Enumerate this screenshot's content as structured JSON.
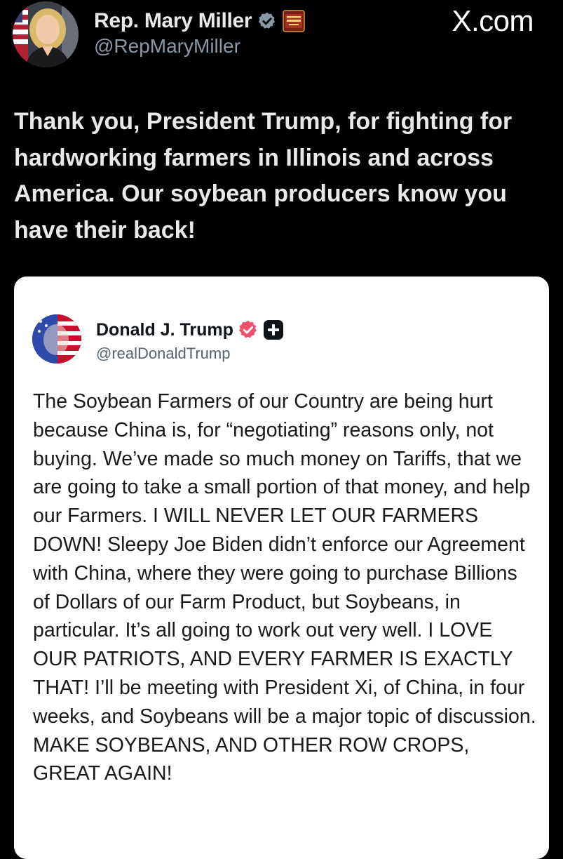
{
  "post": {
    "author": {
      "name": "Rep. Mary Miller",
      "handle": "@RepMaryMiller",
      "avatar_icon": "profile-photo",
      "verified_color": "#8b98a5"
    },
    "site_label": "X.com",
    "text": "Thank you, President Trump, for fighting for hardworking farmers in Illinois and across America. Our soybean producers know you have their back!"
  },
  "quoted_post": {
    "author": {
      "name": "Donald J. Trump",
      "handle": "@realDonaldTrump",
      "avatar_icon": "flag-portrait",
      "verified_color": "#f0506e"
    },
    "text": "The Soybean Farmers of our Country are being hurt because China is, for “negotiating” reasons only, not buying. We’ve made so much money on Tariffs, that we are going to take a small portion of that money, and help our Farmers. I WILL NEVER LET OUR FARMERS DOWN! Sleepy Joe Biden didn’t enforce our Agreement with China, where they were going to purchase Billions of Dollars of our Farm Product, but Soybeans, in particular. It’s all going to work out very well. I LOVE OUR PATRIOTS, AND EVERY FARMER IS EXACTLY THAT! I’ll be meeting with President Xi, of China, in four weeks, and Soybeans will be a major topic of discussion. MAKE SOYBEANS, AND OTHER ROW CROPS, GREAT AGAIN!"
  },
  "colors": {
    "background": "#000000",
    "card": "#ffffff",
    "primary_text": "#e7e9ea",
    "secondary_text": "#8b98a5"
  }
}
